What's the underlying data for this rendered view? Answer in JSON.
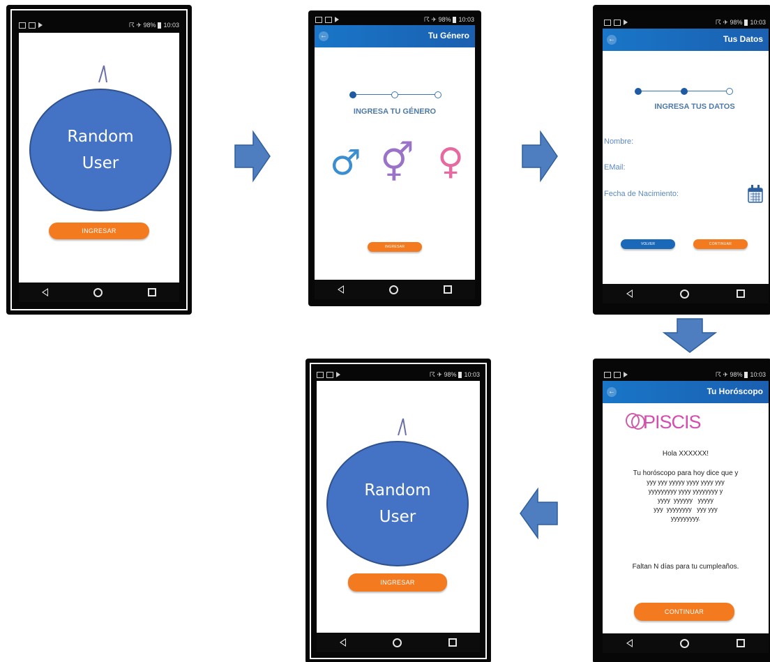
{
  "colors": {
    "accent_orange": "#f47a20",
    "appbar_blue": "#1b6ec2",
    "diagram_circle": "#4472c4",
    "arrow": "#4f7ec0"
  },
  "status": {
    "signal": "☈ ✈ 98%",
    "time": "10:03",
    "time_b": "10:03",
    "time_c": "10:03",
    "time_d": "10:03",
    "time_e": "10:03"
  },
  "screen1": {
    "circle_line1": "Random",
    "circle_line2": "User",
    "button": "INGRESAR"
  },
  "screen2": {
    "title": "Tu Género",
    "step_label": "INGRESA TU GÉNERO",
    "button": "INGRESAR",
    "male_symbol": "♂",
    "intersex_symbol": "⚥",
    "female_symbol": "♀"
  },
  "screen3": {
    "title": "Tus Datos",
    "step_label": "INGRESA TUS DATOS",
    "field_name": "Nombre:",
    "field_email": "EMail:",
    "field_birth": "Fecha de Nacimiento:",
    "btn_back": "VOLVER",
    "btn_continue": "CONTINUAR"
  },
  "screen4": {
    "title": "Tu Horóscopo",
    "sign": "PISCIS",
    "greeting": "Hola XXXXXX!",
    "line1": "Tu horóscopo para hoy dice que y",
    "line2": "yyy yyy yyyyy yyyy yyyy yyy",
    "line3": "yyyyyyyyy yyyy yyyyyyyy y",
    "line4": "yyyy  yyyyyy   yyyyy",
    "line5": "yyy  yyyyyyyy   yyy yyy",
    "line6": "yyyyyyyyy.",
    "birthday": "Faltan N días para tu cumpleaños.",
    "button": "CONTINUAR"
  },
  "screen5": {
    "circle_line1": "Random",
    "circle_line2": "User",
    "button": "INGRESAR"
  }
}
